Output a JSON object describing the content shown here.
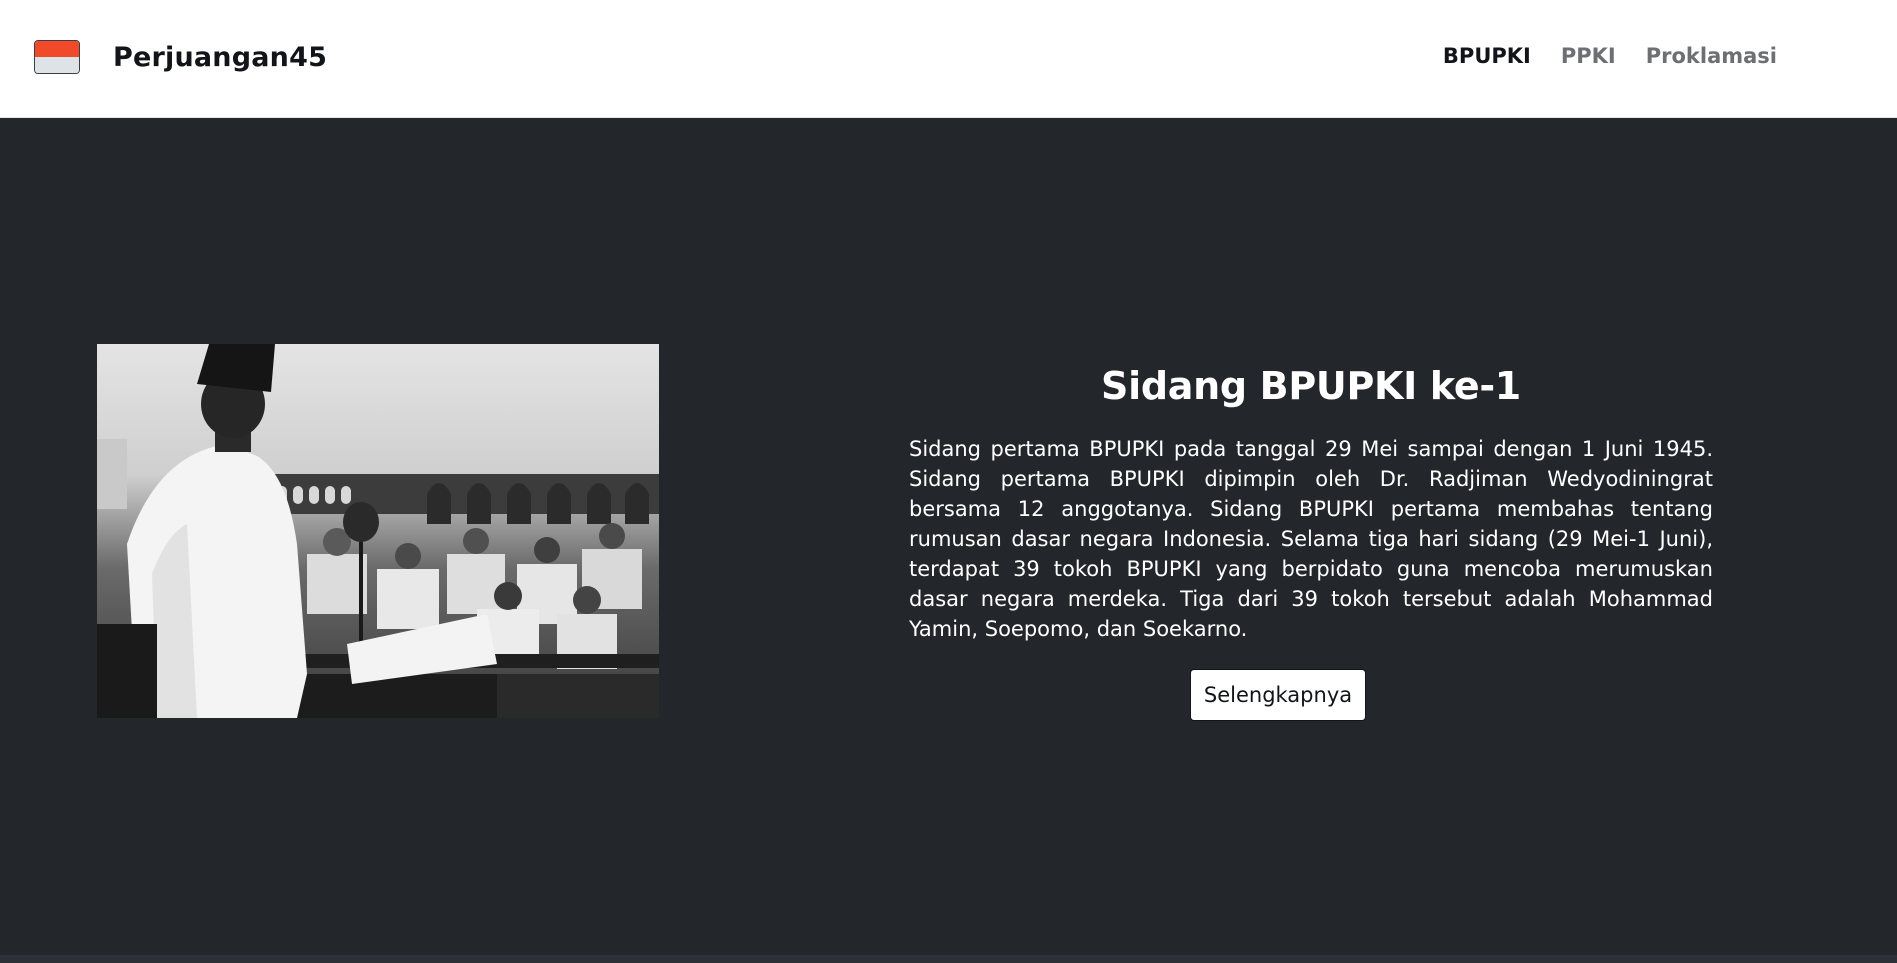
{
  "brand": {
    "name": "Perjuangan45",
    "flag_colors": {
      "top": "#f14a2a",
      "bottom": "#dde3e6"
    }
  },
  "nav": {
    "items": [
      {
        "label": "BPUPKI",
        "active": true
      },
      {
        "label": "PPKI",
        "active": false
      },
      {
        "label": "Proklamasi",
        "active": false
      }
    ]
  },
  "hero": {
    "title": "Sidang BPUPKI ke-1",
    "description": "Sidang pertama BPUPKI pada tanggal 29 Mei sampai dengan 1 Juni 1945. Sidang pertama BPUPKI dipimpin oleh Dr. Radjiman Wedyodiningrat bersama 12 anggotanya. Sidang BPUPKI pertama membahas tentang rumusan dasar negara Indonesia. Selama tiga hari sidang (29 Mei-1 Juni), terdapat 39 tokoh BPUPKI yang berpidato guna mencoba merumuskan dasar negara merdeka. Tiga dari 39 tokoh tersebut adalah Mohammad Yamin, Soepomo, dan Soekarno.",
    "button_label": "Selengkapnya",
    "image_icon": "historical-photo"
  },
  "colors": {
    "background": "#23262b",
    "navbar": "#ffffff",
    "text_light": "#ffffff",
    "nav_active": "#111418",
    "nav_inactive": "#6d6f73"
  }
}
